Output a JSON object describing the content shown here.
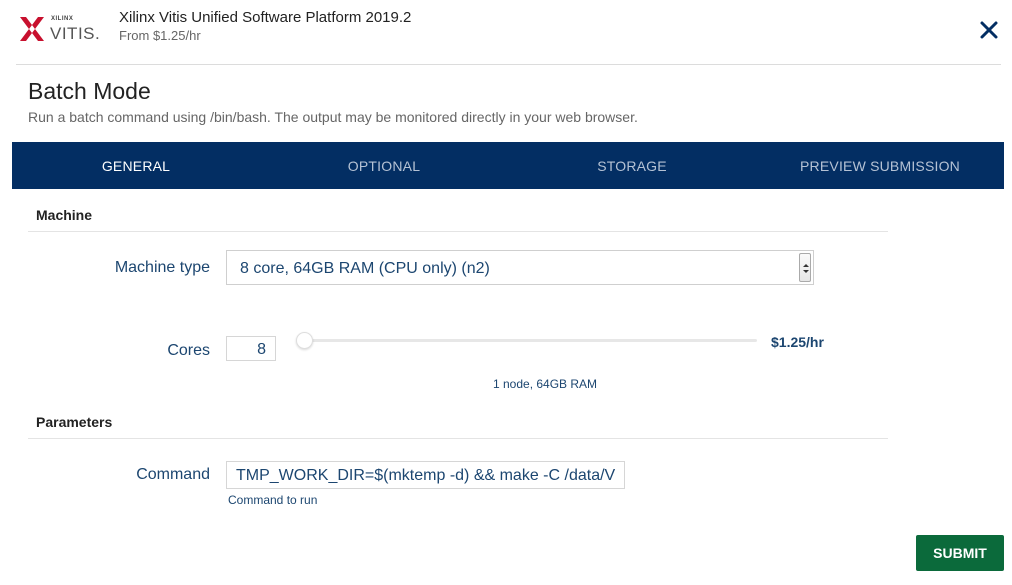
{
  "header": {
    "logo_small": "XILINX",
    "logo_big": "VITIS.",
    "title": "Xilinx Vitis Unified Software Platform 2019.2",
    "price": "From $1.25/hr"
  },
  "page": {
    "title": "Batch Mode",
    "description": "Run a batch command using /bin/bash. The output may be monitored directly in your web browser."
  },
  "tabs": [
    {
      "label": "GENERAL",
      "active": true
    },
    {
      "label": "OPTIONAL",
      "active": false
    },
    {
      "label": "STORAGE",
      "active": false
    },
    {
      "label": "PREVIEW SUBMISSION",
      "active": false
    }
  ],
  "machine": {
    "section_title": "Machine",
    "type_label": "Machine type",
    "type_value": "8 core, 64GB RAM (CPU only) (n2)",
    "cores_label": "Cores",
    "cores_value": "8",
    "price": "$1.25/hr",
    "node_info": "1 node, 64GB RAM"
  },
  "parameters": {
    "section_title": "Parameters",
    "command_label": "Command",
    "command_value": "TMP_WORK_DIR=$(mktemp -d) && make -C /data/V",
    "command_help": "Command to run"
  },
  "submit_label": "SUBMIT",
  "colors": {
    "tab_bar": "#032e63",
    "submit": "#0b6a3b",
    "label_text": "#1c4670",
    "logo_red": "#c8102e"
  }
}
